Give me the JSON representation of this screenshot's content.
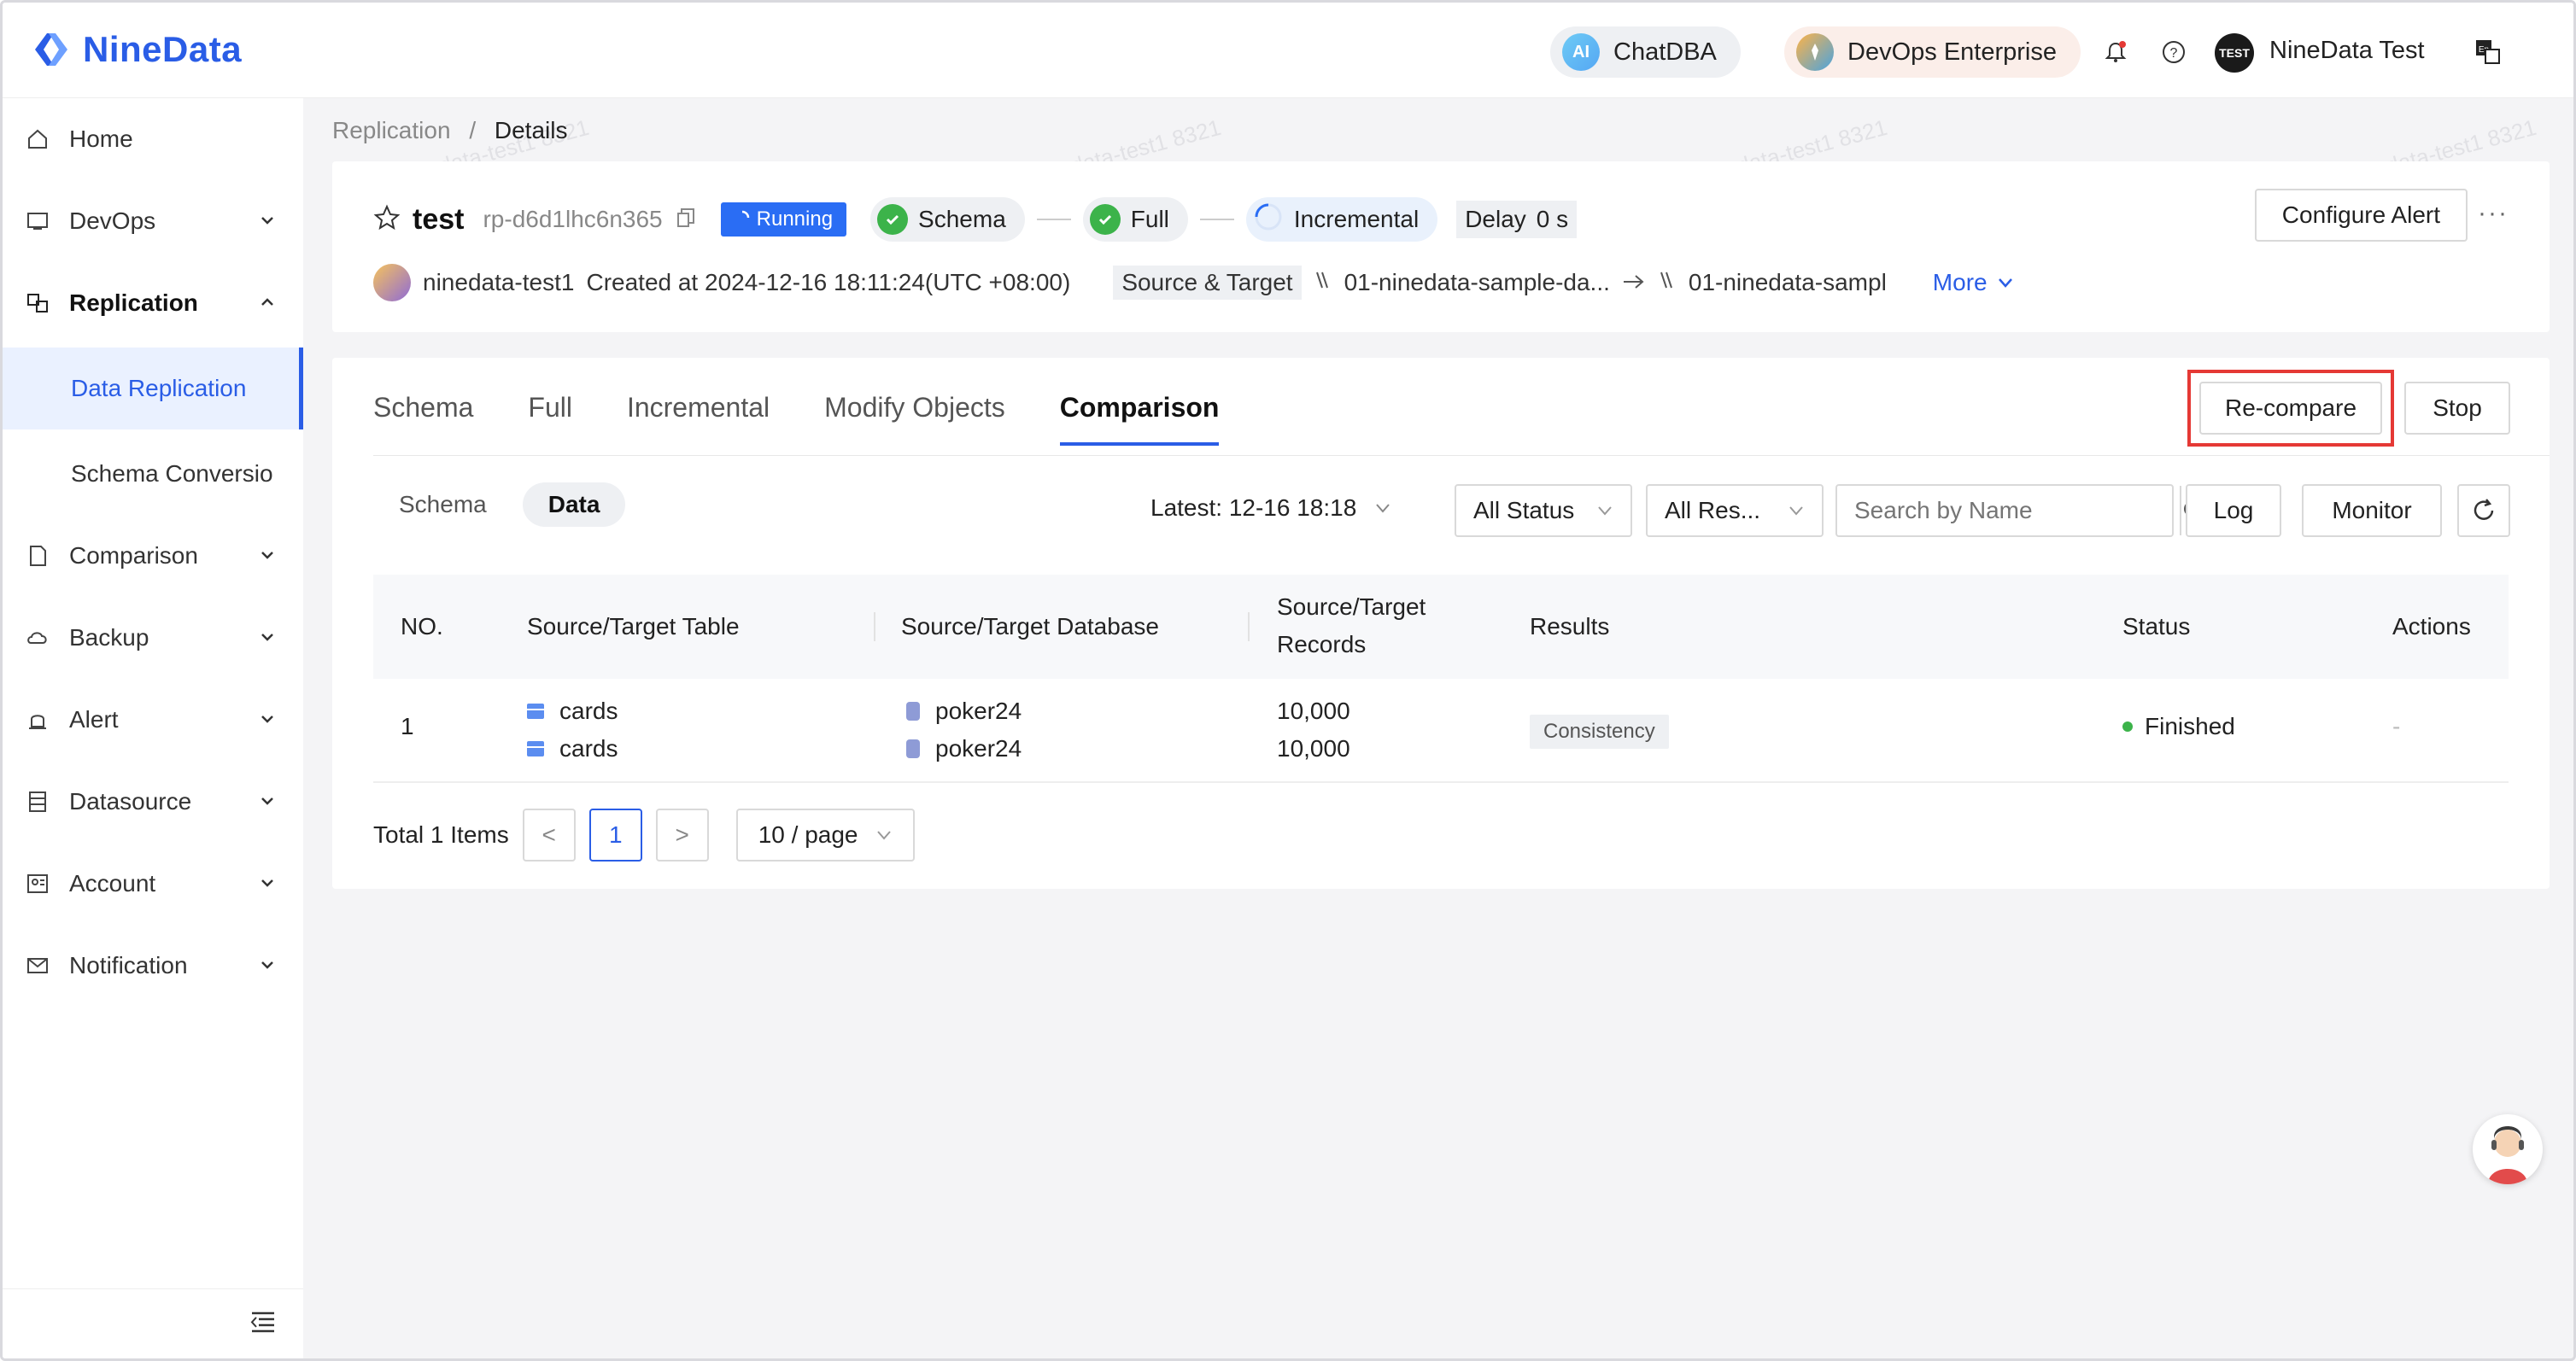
{
  "app": {
    "brand": "NineData",
    "brand_color": "#2a5de6"
  },
  "topbar": {
    "chatdba": "ChatDBA",
    "chatdba_badge": "AI",
    "devops": "DevOps Enterprise",
    "user_avatar": "TEST",
    "user_name": "NineData Test",
    "icons": [
      "bell-icon",
      "help-icon",
      "language-icon"
    ]
  },
  "sidebar": {
    "items": [
      {
        "label": "Home",
        "icon": "home-icon"
      },
      {
        "label": "DevOps",
        "icon": "devops-icon"
      },
      {
        "label": "Replication",
        "icon": "replication-icon"
      },
      {
        "label": "Comparison",
        "icon": "comparison-icon"
      },
      {
        "label": "Backup",
        "icon": "backup-icon"
      },
      {
        "label": "Alert",
        "icon": "alert-icon"
      },
      {
        "label": "Datasource",
        "icon": "datasource-icon"
      },
      {
        "label": "Account",
        "icon": "account-icon"
      },
      {
        "label": "Notification",
        "icon": "notification-icon"
      }
    ],
    "subitems": [
      {
        "label": "Data Replication",
        "active": true
      },
      {
        "label": "Schema Conversio",
        "active": false
      }
    ]
  },
  "breadcrumb": {
    "parent": "Replication",
    "separator": "/",
    "current": "Details"
  },
  "task": {
    "name": "test",
    "id": "rp-d6d1lhc6n365",
    "status": "Running",
    "stages": [
      "Schema",
      "Full",
      "Incremental"
    ],
    "delay_label": "Delay",
    "delay_value": "0 s",
    "creator": "ninedata-test1",
    "created_at": "Created at 2024-12-16 18:11:24(UTC +08:00)",
    "source_target_label": "Source & Target",
    "source": "01-ninedata-sample-da...",
    "target": "01-ninedata-sampl",
    "more_label": "More",
    "configure_alert": "Configure Alert"
  },
  "tabs": [
    "Schema",
    "Full",
    "Incremental",
    "Modify Objects",
    "Comparison"
  ],
  "active_tab": "Comparison",
  "actions": {
    "recompare": "Re-compare",
    "stop": "Stop"
  },
  "filters": {
    "segments": [
      "Schema",
      "Data"
    ],
    "active_segment": "Data",
    "latest": "Latest: 12-16 18:18",
    "status_select": "All Status",
    "result_select": "All Res...",
    "search_placeholder": "Search by Name",
    "log": "Log",
    "monitor": "Monitor"
  },
  "table": {
    "columns": [
      "NO.",
      "Source/Target Table",
      "Source/Target Database",
      "Source/Target Records",
      "Results",
      "Status",
      "Actions"
    ],
    "rows": [
      {
        "no": "1",
        "source_table": "cards",
        "target_table": "cards",
        "source_db": "poker24",
        "target_db": "poker24",
        "source_records": "10,000",
        "target_records": "10,000",
        "result": "Consistency",
        "status": "Finished",
        "actions": "-"
      }
    ]
  },
  "pagination": {
    "total": "Total 1 Items",
    "prev": "<",
    "page": "1",
    "next": ">",
    "page_size": "10 / page"
  },
  "watermark": "ninedata-test1 8321"
}
